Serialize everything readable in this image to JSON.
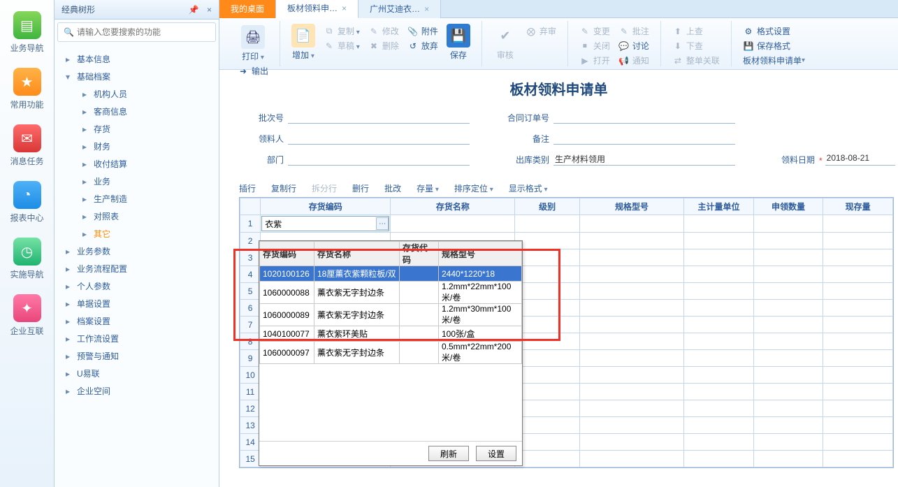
{
  "nav": [
    {
      "label": "业务导航",
      "cls": "ic-green",
      "glyph": "▤"
    },
    {
      "label": "常用功能",
      "cls": "ic-orange",
      "glyph": "★"
    },
    {
      "label": "消息任务",
      "cls": "ic-red",
      "glyph": "✉"
    },
    {
      "label": "报表中心",
      "cls": "ic-blue",
      "glyph": "◔"
    },
    {
      "label": "实施导航",
      "cls": "ic-green2",
      "glyph": "◷"
    },
    {
      "label": "企业互联",
      "cls": "ic-pink",
      "glyph": "✦"
    }
  ],
  "tree": {
    "title": "经典树形",
    "search_placeholder": "请输入您要搜索的功能",
    "top": [
      {
        "label": "基本信息",
        "expand": ">"
      },
      {
        "label": "基础档案",
        "expand": "v",
        "children": [
          {
            "label": "机构人员"
          },
          {
            "label": "客商信息"
          },
          {
            "label": "存货"
          },
          {
            "label": "财务"
          },
          {
            "label": "收付结算"
          },
          {
            "label": "业务"
          },
          {
            "label": "生产制造"
          },
          {
            "label": "对照表"
          },
          {
            "label": "其它",
            "hl": true
          }
        ]
      },
      {
        "label": "业务参数"
      },
      {
        "label": "业务流程配置"
      },
      {
        "label": "个人参数"
      },
      {
        "label": "单据设置"
      },
      {
        "label": "档案设置"
      },
      {
        "label": "工作流设置"
      },
      {
        "label": "预警与通知"
      },
      {
        "label": "U易联"
      },
      {
        "label": "企业空间"
      }
    ]
  },
  "tabs": [
    {
      "label": "我的桌面",
      "style": "orange"
    },
    {
      "label": "板材领料申…",
      "style": "active",
      "close": true
    },
    {
      "label": "广州艾迪衣…",
      "close": true
    }
  ],
  "toolbar": {
    "print": "打印",
    "output": "输出",
    "add": "增加",
    "copy": "复制",
    "draft": "草稿",
    "modify": "修改",
    "delete": "删除",
    "attach": "附件",
    "abandon": "放弃",
    "save": "保存",
    "audit": "审核",
    "discard": "弃审",
    "change": "变更",
    "close": "关闭",
    "open": "打开",
    "note": "批注",
    "discuss": "讨论",
    "notify": "通知",
    "submit": "上查",
    "query": "下查",
    "link": "整单关联",
    "formatset": "格式设置",
    "saveformat": "保存格式",
    "doc": "板材领料申请单"
  },
  "form": {
    "title": "板材领料申请单",
    "batch_label": "批次号",
    "contract_label": "合同订单号",
    "picker_label": "领料人",
    "remark_label": "备注",
    "dept_label": "部门",
    "outtype_label": "出库类别",
    "outtype_value": "生产材料领用",
    "date_label": "领料日期",
    "date_value": "2018-08-21"
  },
  "gridtools": {
    "insert": "插行",
    "copyrow": "复制行",
    "split": "拆分行",
    "delrow": "删行",
    "batch": "批改",
    "stock": "存量",
    "sort": "排序定位",
    "display": "显示格式"
  },
  "grid": {
    "headers": {
      "code": "存货编码",
      "name": "存货名称",
      "cat": "级别",
      "spec": "规格型号",
      "unit": "主计量单位",
      "qty": "申领数量",
      "stock": "现存量"
    },
    "input_value": "衣紫",
    "rows": 15
  },
  "popup": {
    "headers": {
      "code": "存货编码",
      "name": "存货名称",
      "alias": "存货代码",
      "spec": "规格型号"
    },
    "items": [
      {
        "code": "1020100126",
        "name": "18厘薰衣紫颗粒板/双",
        "alias": "",
        "spec": "2440*1220*18",
        "sel": true
      },
      {
        "code": "1060000088",
        "name": "薰衣紫无字封边条",
        "alias": "",
        "spec": "1.2mm*22mm*100米/卷"
      },
      {
        "code": "1060000089",
        "name": "薰衣紫无字封边条",
        "alias": "",
        "spec": "1.2mm*30mm*100米/卷"
      },
      {
        "code": "1040100077",
        "name": "薰衣紫环美贴",
        "alias": "",
        "spec": "100张/盒"
      },
      {
        "code": "1060000097",
        "name": "薰衣紫无字封边条",
        "alias": "",
        "spec": "0.5mm*22mm*200米/卷"
      }
    ],
    "refresh": "刷新",
    "settings": "设置"
  }
}
